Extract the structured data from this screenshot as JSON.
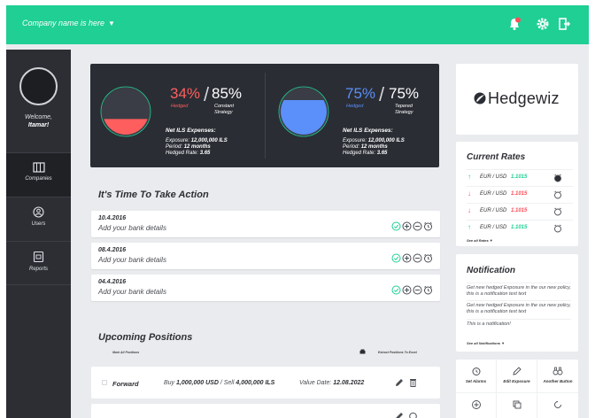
{
  "header": {
    "company_name": "Company name is here",
    "caret": "▼",
    "icons": [
      "bell-icon",
      "gear-icon",
      "logout-icon"
    ],
    "accent_color": "#1fcf94",
    "badge_color": "#ff4d5a"
  },
  "sidebar": {
    "welcome": "Welcome,",
    "user": "Itamar!",
    "items": [
      {
        "label": "Companies",
        "icon": "companies-icon"
      },
      {
        "label": "Users",
        "icon": "users-icon"
      },
      {
        "label": "Reports",
        "icon": "reports-icon"
      }
    ]
  },
  "banner": {
    "left": {
      "hedged_pct": "34%",
      "hedged_label": "Hedged",
      "strategy_pct": "85%",
      "strategy_label_1": "Constant",
      "strategy_label_2": "Strategy",
      "fill_fraction": 0.34,
      "fill_color": "#ff5e5e",
      "net_title": "Net ILS Expenses:",
      "exposure_label": "Exposure:",
      "exposure_value": "12,000,000 ILS",
      "period_label": "Period:",
      "period_value": "12 months",
      "rate_label": "Hedged Rate:",
      "rate_value": "3.65"
    },
    "right": {
      "hedged_pct": "75%",
      "hedged_label": "Hedged",
      "strategy_pct": "75%",
      "strategy_label_1": "Tepered",
      "strategy_label_2": "Strategy",
      "fill_fraction": 0.75,
      "fill_color": "#5b8ff9",
      "net_title": "Net ILS Expenses:",
      "exposure_label": "Exposure:",
      "exposure_value": "12,000,000 ILS",
      "period_label": "Period:",
      "period_value": "12 months",
      "rate_label": "Hedged Rate:",
      "rate_value": "3.65"
    }
  },
  "actions": {
    "title": "It's Time To Take Action",
    "items": [
      {
        "date": "10.4.2016",
        "text": "Add your bank details"
      },
      {
        "date": "08.4.2016",
        "text": "Add your bank details"
      },
      {
        "date": "04.4.2016",
        "text": "Add your bank details"
      }
    ],
    "icons": [
      "check-circle-icon",
      "plus-circle-icon",
      "minus-circle-icon",
      "alarm-icon"
    ]
  },
  "positions": {
    "title": "Upcoming Positions",
    "mark_all": "Mark All Positions",
    "export": "Extract Positions To Excel",
    "rows": [
      {
        "type": "Forward",
        "buy_label": "Buy",
        "buy": "1,000,000 USD",
        "sell_label": "Sell",
        "sell": "4,000,000 ILS",
        "value_label": "Value Date:",
        "value_date": "12.08.2022"
      }
    ]
  },
  "logo": {
    "text": "Hedgewiz"
  },
  "rates": {
    "title": "Current Rates",
    "items": [
      {
        "dir": "↑",
        "pair": "EUR / USD",
        "value": "1.1015",
        "color": "#1fcf94"
      },
      {
        "dir": "↓",
        "pair": "EUR / USD",
        "value": "1.1015",
        "color": "#ff4d5a"
      },
      {
        "dir": "↓",
        "pair": "EUR / USD",
        "value": "1.1015",
        "color": "#ff4d5a"
      },
      {
        "dir": "↑",
        "pair": "EUR / USD",
        "value": "1.1015",
        "color": "#1fcf94"
      }
    ],
    "see_all": "See all Rates ▼"
  },
  "notification": {
    "title": "Notification",
    "items": [
      "Get new hedged Exposure in the our new policy, this is a notification text text",
      "Get new hedged Exposure in the our new policy, this is a notification text text",
      "This is a notification!"
    ],
    "see_all": "See all Notifications ▼"
  },
  "quick_buttons": [
    {
      "label": "Set Alarms",
      "icon": "alarm-icon"
    },
    {
      "label": "Edit Exposure",
      "icon": "pencil-icon"
    },
    {
      "label": "Another Button",
      "icon": "binoculars-icon"
    }
  ]
}
